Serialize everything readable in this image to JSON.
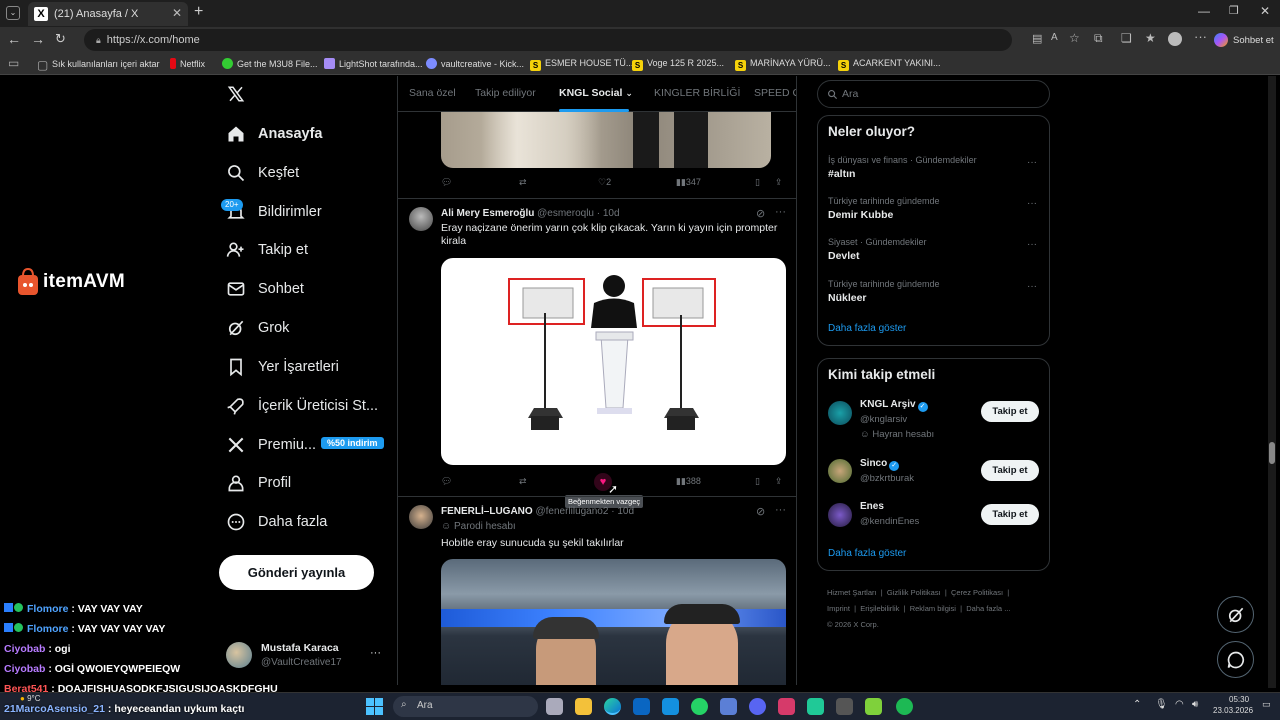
{
  "browser": {
    "tab_title": "(21) Anasayfa / X",
    "url": "https://x.com/home",
    "profile_button": "Sohbet et",
    "bookmarks": [
      {
        "label": "Sık kullanılanları içeri aktar"
      },
      {
        "label": "Netflix"
      },
      {
        "label": "Get the M3U8 File..."
      },
      {
        "label": "LightShot tarafında..."
      },
      {
        "label": "vaultcreative - Kick..."
      },
      {
        "label": "ESMER HOUSE TÜ..."
      },
      {
        "label": "Voge 125 R 2025..."
      },
      {
        "label": "MARİNAYA YÜRÜ..."
      },
      {
        "label": "ACARKENT YAKINI..."
      }
    ]
  },
  "overlay": {
    "logo_text": "itemAVM"
  },
  "nav": {
    "items": [
      {
        "label": "Anasayfa"
      },
      {
        "label": "Keşfet"
      },
      {
        "label": "Bildirimler"
      },
      {
        "label": "Takip et"
      },
      {
        "label": "Sohbet"
      },
      {
        "label": "Grok"
      },
      {
        "label": "Yer İşaretleri"
      },
      {
        "label": "İçerik Üreticisi St..."
      },
      {
        "label": "Premiu..."
      },
      {
        "label": "Profil"
      },
      {
        "label": "Daha fazla"
      }
    ],
    "notif_badge": "20+",
    "premium_badge": "%50 indirim",
    "post_button": "Gönderi yayınla",
    "account": {
      "name": "Mustafa Karaca",
      "handle": "@VaultCreative17"
    }
  },
  "feed": {
    "tabs": [
      {
        "label": "Sana özel"
      },
      {
        "label": "Takip ediliyor"
      },
      {
        "label": "KNGL Social"
      },
      {
        "label": "KINGLER BİRLİĞİ"
      },
      {
        "label": "SPEED G"
      }
    ],
    "post0": {
      "likes": "2",
      "views": "347"
    },
    "post1": {
      "name": "Ali Mery Esmeroğlu",
      "handle": "@esmeroqlu",
      "time": "· 10d",
      "text": "Eray naçizane önerim yarın çok klip çıkacak. Yarın ki yayın için prompter kirala",
      "views": "388",
      "tooltip": "Beğenmekten vazgeç"
    },
    "post2": {
      "name": "FENERLİ–LUGANO",
      "handle": "@fenerlilugano2",
      "time": "· 10d",
      "badge": "Parodi hesabı",
      "text": "Hobitle eray sunucuda şu şekil takılırlar"
    }
  },
  "right": {
    "search_placeholder": "Ara",
    "trends_title": "Neler oluyor?",
    "trends": [
      {
        "context": "İş dünyası ve finans · Gündemdekiler",
        "title": "#altın"
      },
      {
        "context": "Türkiye tarihinde gündemde",
        "title": "Demir Kubbe"
      },
      {
        "context": "Siyaset · Gündemdekiler",
        "title": "Devlet"
      },
      {
        "context": "Türkiye tarihinde gündemde",
        "title": "Nükleer"
      }
    ],
    "show_more": "Daha fazla göster",
    "who_title": "Kimi takip etmeli",
    "who": [
      {
        "name": "KNGL Arşiv",
        "handle": "@knglarsiv",
        "extra": "Hayran hesabı",
        "button": "Takip et"
      },
      {
        "name": "Sinco",
        "handle": "@bzkrtburak",
        "button": "Takip et"
      },
      {
        "name": "Enes",
        "handle": "@kendinEnes",
        "button": "Takip et"
      }
    ],
    "footer": [
      "Hizmet Şartları",
      "|",
      "Gizlilik Politikası",
      "|",
      "Çerez Politikası",
      "|",
      "Imprint",
      "|",
      "Erişilebilirlik",
      "|",
      "Reklam bilgisi",
      "|",
      "Daha fazla ...",
      "© 2026 X Corp."
    ]
  },
  "chat": [
    {
      "user": "Flomore",
      "msg": ": VAY VAY VAY",
      "color": "#4fa3ff"
    },
    {
      "user": "Flomore",
      "msg": ": VAY VAY VAY VAY",
      "color": "#4fa3ff"
    },
    {
      "user": "Ciyobab",
      "msg": ": ogi",
      "color": "#b77bff"
    },
    {
      "user": "Ciyobab",
      "msg": ": OGİ QWOIEYQWPEIEQW",
      "color": "#b77bff"
    },
    {
      "user": "Berat541",
      "msg": ": DOAJFISHUASODKFJSIGUSIJOASKDFGHU",
      "color": "#ff5555"
    },
    {
      "user": "21MarcoAsensio_21",
      "msg": ": heyeceandan uykum kaçtı",
      "color": "#8ab4ff"
    }
  ],
  "taskbar": {
    "search": "Ara",
    "weather": "9°C",
    "time": "05:30",
    "date": "23.03.2026"
  },
  "colors": {
    "accent": "#1d9bf0",
    "like": "#f91880",
    "bg": "#000000",
    "border": "#2f3336"
  }
}
